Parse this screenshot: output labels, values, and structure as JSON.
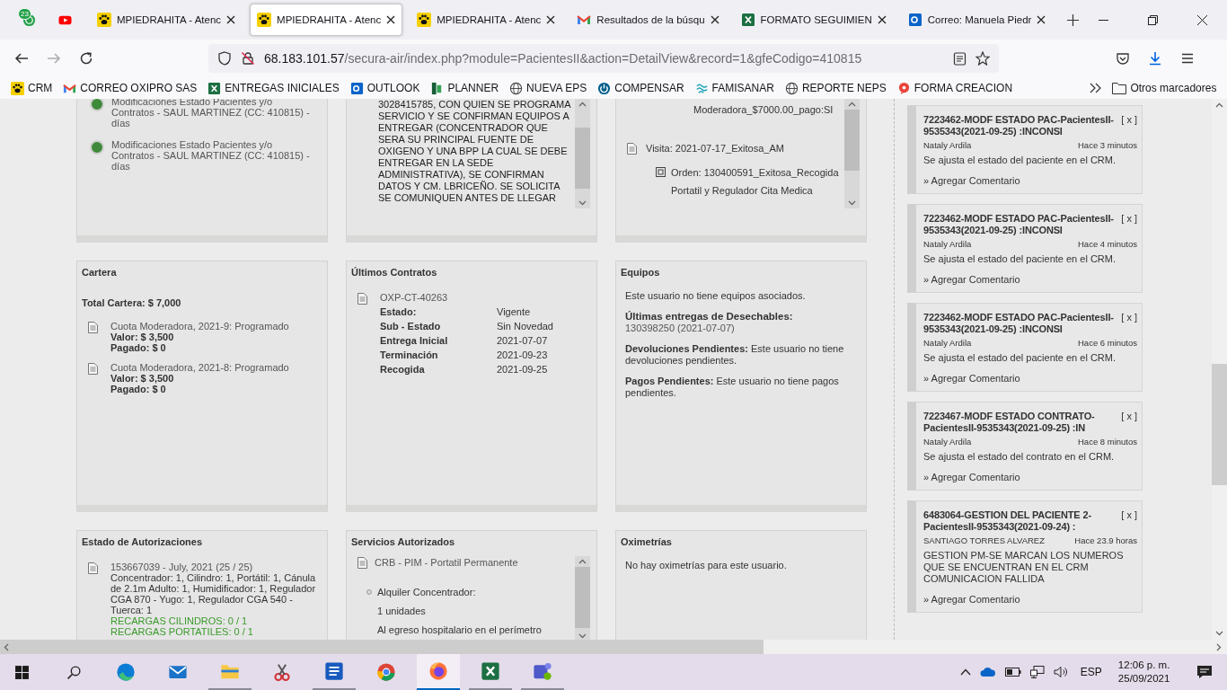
{
  "browser": {
    "pinned_tabs": [
      {
        "kind": "chat",
        "badge": "23"
      },
      {
        "kind": "video"
      }
    ],
    "tabs": [
      {
        "kind": "paw",
        "title": "MPIEDRAHITA - Atenc",
        "selected": false
      },
      {
        "kind": "paw",
        "title": "MPIEDRAHITA - Atenc",
        "selected": true
      },
      {
        "kind": "paw",
        "title": "MPIEDRAHITA - Atenc",
        "selected": false
      },
      {
        "kind": "gmail",
        "title": "Resultados de la búsqu",
        "selected": false
      },
      {
        "kind": "excel",
        "title": "FORMATO SEGUIMIEN",
        "selected": false
      },
      {
        "kind": "outlook",
        "title": "Correo: Manuela Piedr",
        "selected": false
      }
    ],
    "address": {
      "host": "68.183.101.57",
      "path": "/secura-air/index.php?module=PacientesII&action=DetailView&record=1&gfeCodigo=410815"
    },
    "bookmarks": [
      {
        "kind": "paw",
        "label": "CRM"
      },
      {
        "kind": "gmail",
        "label": "CORREO OXIPRO SAS"
      },
      {
        "kind": "excel",
        "label": "ENTREGAS INICIALES"
      },
      {
        "kind": "outlook",
        "label": "OUTLOOK"
      },
      {
        "kind": "planner",
        "label": "PLANNER"
      },
      {
        "kind": "globe",
        "label": "NUEVA EPS"
      },
      {
        "kind": "power",
        "label": "COMPENSAR"
      },
      {
        "kind": "wave",
        "label": "FAMISANAR"
      },
      {
        "kind": "globe",
        "label": "REPORTE NEPS"
      },
      {
        "kind": "bubble",
        "label": "FORMA CREACION"
      }
    ],
    "other_bookmarks": "Otros marcadores"
  },
  "top_panels": {
    "modifications": [
      {
        "text": "Modificaciones Estado Pacientes y/o Contratos - SAUL MARTINEZ (CC: 410815) - días"
      },
      {
        "text": "Modificaciones Estado Pacientes y/o Contratos - SAUL MARTINEZ (CC: 410815) - días"
      }
    ],
    "note": "3028415785, CON QUIEN SE PROGRAMA SERVICIO Y SE CONFIRMAN EQUIPOS A ENTREGAR (CONCENTRADOR QUE SERA SU PRINCIPAL FUENTE DE OXIGENO Y UNA BPP LA CUAL SE DEBE ENTREGAR EN LA SEDE ADMINISTRATIVA), SE CONFIRMAN DATOS Y CM. LBRICEÑO. SE SOLICITA SE COMUNIQUEN ANTES DE LLEGAR",
    "visits": {
      "payment": "Moderadora_$7000.00_pago:SI",
      "visit": "Visita: 2021-07-17_Exitosa_AM",
      "order": "Orden: 130400591_Exitosa_Recogida Portatil y Regulador Cita Medica"
    }
  },
  "cartera": {
    "title": "Cartera",
    "total": "Total Cartera: $ 7,000",
    "items": [
      {
        "title": "Cuota Moderadora, 2021-9: Programado",
        "valor": "Valor: $ 3,500",
        "pagado": "Pagado: $ 0"
      },
      {
        "title": "Cuota Moderadora, 2021-8: Programado",
        "valor": "Valor: $ 3,500",
        "pagado": "Pagado: $ 0"
      }
    ]
  },
  "contratos": {
    "title": "Últimos Contratos",
    "contract": "OXP-CT-40263",
    "fields": [
      {
        "label": "Estado:",
        "value": "Vigente"
      },
      {
        "label": "Sub - Estado",
        "value": "Sin Novedad"
      },
      {
        "label": "Entrega Inicial",
        "value": "2021-07-07"
      },
      {
        "label": "Terminación",
        "value": "2021-09-23"
      },
      {
        "label": "Recogida",
        "value": "2021-09-25"
      }
    ]
  },
  "equipos": {
    "title": "Equipos",
    "none": "Este usuario no tiene equipos asociados.",
    "disposables_label": "Últimas entregas de Desechables:",
    "disposables_link": "130398250 (2021-07-07)",
    "pending": [
      "**Devoluciones Pendientes:** Este usuario no tiene devoluciones pendientes.",
      "**Pagos Pendientes:** Este usuario no tiene pagos pendientes."
    ]
  },
  "autorizaciones": {
    "title": "Estado de Autorizaciones",
    "item": {
      "title": "153667039 - July, 2021 (25 / 25)",
      "detail": "Concentrador: 1, Cilindro: 1, Portátil: 1, Cánula de 2.1m Adulto: 1, Humidificador: 1, Regulador CGA 870 - Yugo: 1, Regulador CGA 540 - Tuerca: 1",
      "recharges": [
        "RECARGAS CILINDROS: 0 / 1",
        "RECARGAS PORTATILES: 0 / 1"
      ]
    }
  },
  "servicios": {
    "title": "Servicios Autorizados",
    "service": "CRB - PIM - Portatil Permanente",
    "bullet": "Alquiler Concentrador:",
    "lines": [
      "1 unidades",
      "Al egreso hospitalario en el perímetro"
    ]
  },
  "oximetrias": {
    "title": "Oximetrías",
    "text": "No hay oximetrías para este usuario."
  },
  "feed": [
    {
      "title": "7223462-MODF ESTADO PAC-PacientesII-9535343(2021-09-25) :INCONSI",
      "close": "[ x ]",
      "author": "Nataly Ardila",
      "time": "Hace 3 minutos",
      "body": "Se ajusta el estado del paciente en el CRM.",
      "link": "» Agregar Comentario"
    },
    {
      "title": "7223462-MODF ESTADO PAC-PacientesII-9535343(2021-09-25) :INCONSI",
      "close": "[ x ]",
      "author": "Nataly Ardila",
      "time": "Hace 4 minutos",
      "body": "Se ajusta el estado del paciente en el CRM.",
      "link": "» Agregar Comentario"
    },
    {
      "title": "7223462-MODF ESTADO PAC-PacientesII-9535343(2021-09-25) :INCONSI",
      "close": "[ x ]",
      "author": "Nataly Ardila",
      "time": "Hace 6 minutos",
      "body": "Se ajusta el estado del paciente en el CRM.",
      "link": "» Agregar Comentario"
    },
    {
      "title": "7223467-MODF ESTADO CONTRATO-PacientesII-9535343(2021-09-25) :IN",
      "close": "[ x ]",
      "author": "Nataly Ardila",
      "time": "Hace 8 minutos",
      "body": "Se ajusta el estado del contrato en el CRM.",
      "link": "» Agregar Comentario"
    },
    {
      "title": "6483064-GESTION DEL PACIENTE 2-PacientesII-9535343(2021-09-24) :",
      "close": "[ x ]",
      "author": "SANTIAGO TORRES ALVAREZ",
      "time": "Hace 23.9 horas",
      "body": "GESTION PM-SE MARCAN LOS NUMEROS QUE SE ENCUENTRAN EN EL CRM COMUNICACION FALLIDA",
      "link": "» Agregar Comentario"
    }
  ],
  "taskbar": {
    "apps": [
      {
        "kind": "start",
        "running": false,
        "selected": false
      },
      {
        "kind": "search",
        "running": false,
        "selected": false
      },
      {
        "kind": "edge",
        "running": false,
        "selected": false
      },
      {
        "kind": "mail",
        "running": false,
        "selected": false
      },
      {
        "kind": "folder",
        "running": true,
        "selected": false
      },
      {
        "kind": "snip",
        "running": false,
        "selected": false
      },
      {
        "kind": "word",
        "running": true,
        "selected": false
      },
      {
        "kind": "chrome",
        "running": false,
        "selected": false
      },
      {
        "kind": "firefox",
        "running": true,
        "selected": true
      },
      {
        "kind": "excel",
        "running": true,
        "selected": false
      },
      {
        "kind": "teams",
        "running": true,
        "selected": false
      }
    ],
    "language": "ESP",
    "time": "12:06 p. m.",
    "date": "25/09/2021"
  }
}
